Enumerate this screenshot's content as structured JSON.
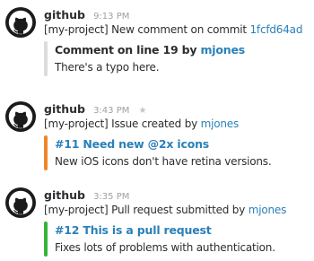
{
  "messages": [
    {
      "author": "github",
      "time": "9:13 PM",
      "starred": false,
      "line_prefix": "[my-project] New comment on commit ",
      "line_link": "1fcfd64ad",
      "attachment": {
        "bar_color": "#dcdcdf",
        "title_prefix": "Comment on line 19 by ",
        "title_link": "mjones",
        "text": "There's a typo here."
      }
    },
    {
      "author": "github",
      "time": "3:43 PM",
      "star_glyph": "★",
      "line_prefix": "[my-project] Issue created by ",
      "line_link": "mjones",
      "attachment": {
        "bar_color": "#f0862b",
        "title": "#11 Need new @2x icons",
        "text": "New iOS icons don't have retina versions."
      }
    },
    {
      "author": "github",
      "time": "3:35 PM",
      "starred": false,
      "line_prefix": "[my-project] Pull request submitted by ",
      "line_link": "mjones",
      "attachment": {
        "bar_color": "#36b339",
        "title": "#12 This is a pull request",
        "text": "Fixes lots of problems with authentication."
      }
    }
  ],
  "icons": {
    "avatar": "github-octocat-icon",
    "star": "star-icon"
  },
  "colors": {
    "link": "#2a80b9",
    "timestamp": "#9e9ea6",
    "text": "#2c2d30"
  }
}
